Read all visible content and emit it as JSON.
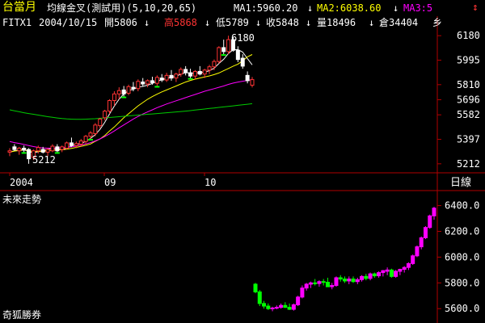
{
  "header": {
    "contract": "台當月",
    "indicator": "均線金叉(測試用)(5,10,20,65)",
    "ma1": "MA1:5960.20",
    "ma2": "MA2:6038.60",
    "ma3": "MA3:5",
    "arrow": "↓",
    "top_arrow": "↕"
  },
  "info": {
    "symbol": "FITX1",
    "date": "2004/10/15",
    "open": "開5806",
    "high": "高5868",
    "low": "低5789",
    "close": "收5848",
    "volume": "量18496",
    "oi": "倉34404",
    "extra": "乡"
  },
  "axis_top": {
    "labels": [
      "6180",
      "5995",
      "5810",
      "5696",
      "5582",
      "5397",
      "5212"
    ]
  },
  "annotations": {
    "peak": "6180",
    "trough": "5212"
  },
  "xaxis": {
    "labels": [
      "2004",
      "09",
      "10"
    ]
  },
  "corner": {
    "daily": "日線"
  },
  "lower": {
    "title": "未來走勢",
    "footer": "奇狐勝券"
  },
  "axis_bottom": {
    "labels": [
      "6400.0",
      "6200.0",
      "6000.0",
      "5800.0",
      "5600.0"
    ]
  },
  "colors": {
    "background": "#000000",
    "up": "#ff3333",
    "down": "#ffffff",
    "green": "#00ff00",
    "magenta": "#ff00ff",
    "ma1": "#ffffff",
    "ma2": "#ffff00",
    "ma3": "#ff00ff",
    "ma4": "#00cc00",
    "grid": "#b00000"
  },
  "chart_data": [
    {
      "type": "candlestick",
      "title": "台當月",
      "ylim": [
        5150,
        6230
      ],
      "ticks": [
        6180,
        5995,
        5810,
        5696,
        5582,
        5397,
        5212
      ],
      "x_labels": [
        "2004",
        "09",
        "10"
      ],
      "ohlc": [
        [
          5300,
          5330,
          5270,
          5310
        ],
        [
          5340,
          5360,
          5310,
          5320
        ],
        [
          5310,
          5340,
          5280,
          5330
        ],
        [
          5330,
          5350,
          5300,
          5315
        ],
        [
          5320,
          5330,
          5212,
          5250
        ],
        [
          5260,
          5320,
          5240,
          5310
        ],
        [
          5310,
          5350,
          5290,
          5335
        ],
        [
          5320,
          5340,
          5290,
          5300
        ],
        [
          5300,
          5330,
          5270,
          5320
        ],
        [
          5310,
          5360,
          5300,
          5345
        ],
        [
          5340,
          5360,
          5300,
          5310
        ],
        [
          5320,
          5350,
          5300,
          5340
        ],
        [
          5330,
          5380,
          5320,
          5370
        ],
        [
          5370,
          5410,
          5340,
          5350
        ],
        [
          5350,
          5380,
          5330,
          5365
        ],
        [
          5360,
          5400,
          5340,
          5385
        ],
        [
          5380,
          5430,
          5360,
          5420
        ],
        [
          5420,
          5460,
          5400,
          5445
        ],
        [
          5440,
          5520,
          5420,
          5505
        ],
        [
          5500,
          5560,
          5480,
          5550
        ],
        [
          5560,
          5620,
          5540,
          5610
        ],
        [
          5610,
          5700,
          5590,
          5690
        ],
        [
          5690,
          5760,
          5650,
          5740
        ],
        [
          5740,
          5790,
          5700,
          5765
        ],
        [
          5770,
          5800,
          5720,
          5740
        ],
        [
          5745,
          5810,
          5730,
          5795
        ],
        [
          5790,
          5830,
          5760,
          5780
        ],
        [
          5780,
          5850,
          5760,
          5835
        ],
        [
          5830,
          5860,
          5800,
          5815
        ],
        [
          5815,
          5850,
          5790,
          5840
        ],
        [
          5840,
          5870,
          5810,
          5825
        ],
        [
          5820,
          5880,
          5800,
          5865
        ],
        [
          5860,
          5890,
          5830,
          5845
        ],
        [
          5845,
          5900,
          5830,
          5880
        ],
        [
          5880,
          5920,
          5840,
          5860
        ],
        [
          5860,
          5900,
          5830,
          5890
        ],
        [
          5890,
          5940,
          5870,
          5925
        ],
        [
          5925,
          5950,
          5880,
          5900
        ],
        [
          5900,
          5930,
          5860,
          5875
        ],
        [
          5875,
          5920,
          5850,
          5910
        ],
        [
          5910,
          5950,
          5880,
          5890
        ],
        [
          5890,
          5930,
          5860,
          5920
        ],
        [
          5920,
          5960,
          5890,
          5945
        ],
        [
          5945,
          6000,
          5920,
          5985
        ],
        [
          5985,
          6100,
          5970,
          6090
        ],
        [
          6090,
          6150,
          6040,
          6060
        ],
        [
          6060,
          6180,
          6040,
          6150
        ],
        [
          6150,
          6170,
          6060,
          6070
        ],
        [
          6070,
          6100,
          5980,
          6000
        ],
        [
          6010,
          6040,
          5930,
          5950
        ],
        [
          5880,
          5910,
          5820,
          5840
        ],
        [
          5806,
          5868,
          5789,
          5848
        ]
      ],
      "series": [
        {
          "name": "MA1",
          "values": [
            5300,
            5310,
            5316,
            5319,
            5305,
            5296,
            5303,
            5310,
            5320,
            5330,
            5322,
            5321,
            5331,
            5347,
            5359,
            5366,
            5381,
            5404,
            5432,
            5473,
            5525,
            5589,
            5648,
            5700,
            5740,
            5766,
            5775,
            5791,
            5797,
            5806,
            5819,
            5836,
            5846,
            5858,
            5865,
            5874,
            5889,
            5901,
            5897,
            5897,
            5903,
            5905,
            5916,
            5934,
            5970,
            6002,
            6046,
            6074,
            6075,
            6056,
            6007,
            5960
          ]
        },
        {
          "name": "MA2",
          "values": [
            5300,
            5308,
            5312,
            5316,
            5310,
            5306,
            5306,
            5306,
            5310,
            5314,
            5316,
            5318,
            5322,
            5328,
            5336,
            5344,
            5352,
            5362,
            5382,
            5400,
            5425,
            5460,
            5490,
            5525,
            5560,
            5590,
            5620,
            5650,
            5675,
            5700,
            5720,
            5738,
            5755,
            5770,
            5785,
            5800,
            5815,
            5830,
            5842,
            5852,
            5860,
            5868,
            5876,
            5886,
            5898,
            5915,
            5932,
            5950,
            5965,
            5990,
            6020,
            6038
          ]
        },
        {
          "name": "MA3",
          "values": [
            5380,
            5372,
            5366,
            5358,
            5350,
            5342,
            5336,
            5332,
            5330,
            5330,
            5332,
            5334,
            5336,
            5340,
            5346,
            5354,
            5362,
            5372,
            5385,
            5400,
            5418,
            5438,
            5460,
            5484,
            5506,
            5528,
            5550,
            5570,
            5588,
            5604,
            5620,
            5636,
            5650,
            5664,
            5676,
            5688,
            5700,
            5712,
            5724,
            5736,
            5748,
            5760,
            5770,
            5780,
            5790,
            5800,
            5812,
            5822,
            5830,
            5836,
            5842,
            5848
          ]
        },
        {
          "name": "MA4",
          "values": [
            5620,
            5612,
            5605,
            5598,
            5592,
            5586,
            5580,
            5574,
            5568,
            5563,
            5558,
            5554,
            5551,
            5549,
            5548,
            5548,
            5549,
            5551,
            5553,
            5556,
            5559,
            5562,
            5565,
            5568,
            5571,
            5574,
            5577,
            5580,
            5583,
            5586,
            5589,
            5592,
            5595,
            5598,
            5601,
            5604,
            5607,
            5610,
            5614,
            5618,
            5622,
            5626,
            5630,
            5634,
            5638,
            5642,
            5646,
            5650,
            5654,
            5658,
            5662,
            5666
          ]
        }
      ]
    },
    {
      "type": "candlestick",
      "title": "未來走勢",
      "ylim": [
        5520,
        6460
      ],
      "ticks": [
        6400,
        6200,
        6000,
        5800,
        5600
      ],
      "ohlc": [
        [
          5790,
          5800,
          5720,
          5730
        ],
        [
          5730,
          5745,
          5620,
          5640
        ],
        [
          5640,
          5660,
          5600,
          5620
        ],
        [
          5620,
          5640,
          5590,
          5600
        ],
        [
          5600,
          5615,
          5580,
          5605
        ],
        [
          5605,
          5625,
          5595,
          5610
        ],
        [
          5610,
          5640,
          5600,
          5625
        ],
        [
          5625,
          5650,
          5605,
          5610
        ],
        [
          5610,
          5640,
          5590,
          5595
        ],
        [
          5595,
          5640,
          5585,
          5630
        ],
        [
          5630,
          5700,
          5620,
          5690
        ],
        [
          5690,
          5780,
          5680,
          5760
        ],
        [
          5760,
          5800,
          5740,
          5790
        ],
        [
          5790,
          5810,
          5760,
          5800
        ],
        [
          5800,
          5830,
          5780,
          5795
        ],
        [
          5795,
          5820,
          5770,
          5810
        ],
        [
          5810,
          5830,
          5780,
          5805
        ],
        [
          5805,
          5840,
          5790,
          5770
        ],
        [
          5770,
          5800,
          5750,
          5780
        ],
        [
          5780,
          5850,
          5770,
          5840
        ],
        [
          5840,
          5860,
          5810,
          5830
        ],
        [
          5830,
          5850,
          5800,
          5815
        ],
        [
          5815,
          5850,
          5790,
          5830
        ],
        [
          5830,
          5850,
          5800,
          5810
        ],
        [
          5810,
          5840,
          5790,
          5825
        ],
        [
          5825,
          5860,
          5810,
          5850
        ],
        [
          5850,
          5870,
          5820,
          5835
        ],
        [
          5835,
          5880,
          5820,
          5870
        ],
        [
          5870,
          5880,
          5840,
          5855
        ],
        [
          5855,
          5890,
          5840,
          5880
        ],
        [
          5880,
          5900,
          5850,
          5895
        ],
        [
          5890,
          5920,
          5860,
          5900
        ],
        [
          5900,
          5910,
          5840,
          5850
        ],
        [
          5850,
          5900,
          5840,
          5890
        ],
        [
          5890,
          5910,
          5860,
          5905
        ],
        [
          5905,
          5930,
          5880,
          5920
        ],
        [
          5920,
          5960,
          5900,
          5950
        ],
        [
          5950,
          6020,
          5940,
          6010
        ],
        [
          6010,
          6090,
          6000,
          6080
        ],
        [
          6080,
          6160,
          6060,
          6150
        ],
        [
          6150,
          6240,
          6140,
          6230
        ],
        [
          6230,
          6330,
          6220,
          6320
        ],
        [
          6320,
          6390,
          6290,
          6380
        ]
      ]
    }
  ]
}
